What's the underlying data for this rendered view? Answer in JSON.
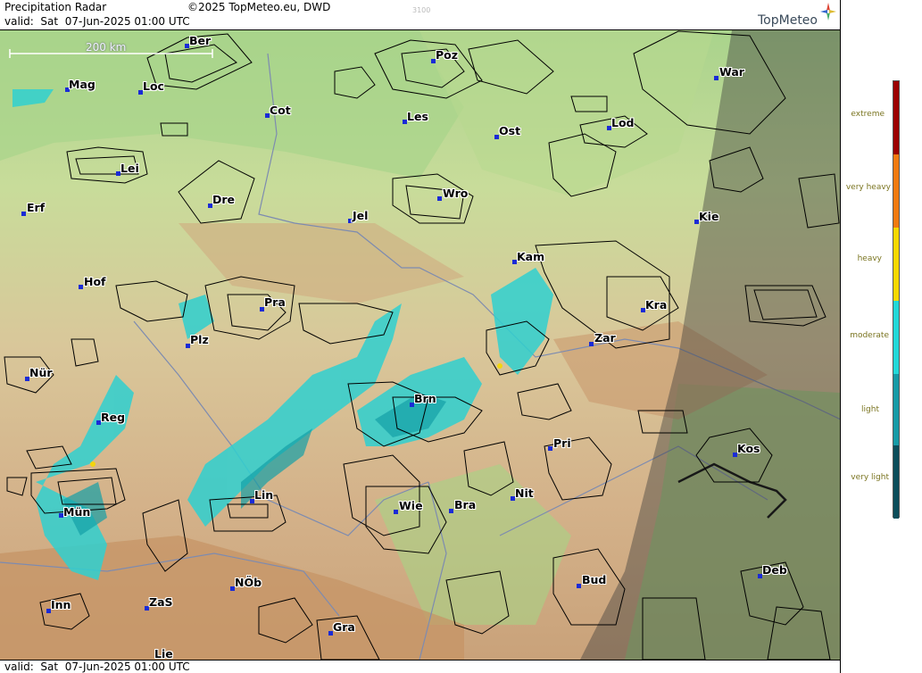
{
  "header": {
    "title": "Precipitation Radar",
    "copyright": "©2025 TopMeteo.eu, DWD",
    "code": "3100",
    "valid": "valid:  Sat  07-Jun-2025 01:00 UTC",
    "brand": "TopMeteo"
  },
  "footer": {
    "valid": "valid:  Sat  07-Jun-2025 01:00 UTC"
  },
  "scale": {
    "label": "200 km"
  },
  "cities": [
    "Ber",
    "Poz",
    "War",
    "Mag",
    "Loc",
    "Cot",
    "Les",
    "Ost",
    "Lod",
    "Lei",
    "Dre",
    "Wro",
    "Erf",
    "Jel",
    "Kie",
    "Kam",
    "Hof",
    "Pra",
    "Kra",
    "Plz",
    "Zar",
    "Nür",
    "Brn",
    "Reg",
    "Pri",
    "Kos",
    "Lin",
    "Nit",
    "Mün",
    "Wie",
    "Bra",
    "Deb",
    "NÖb",
    "Bud",
    "Inn",
    "ZaS",
    "Gra",
    "Lie"
  ],
  "legend": {
    "colors": {
      "extreme": "#9b0000",
      "very_heavy": "#f07a10",
      "heavy": "#f5d800",
      "moderate": "#22d8d8",
      "light": "#169aa6",
      "very_light": "#0b4d5a"
    },
    "labels": {
      "extreme": "extreme",
      "very_heavy": "very heavy",
      "heavy": "heavy",
      "moderate": "moderate",
      "light": "light",
      "very_light": "very light"
    }
  }
}
